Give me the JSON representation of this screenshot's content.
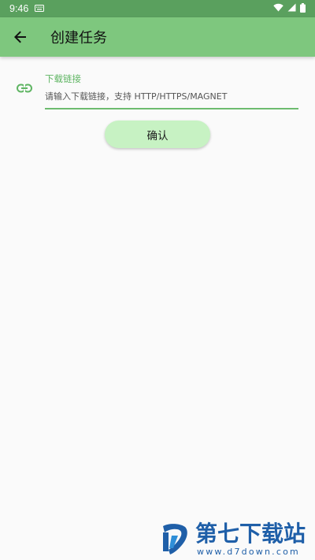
{
  "status_bar": {
    "time": "9:46",
    "icons": [
      "keyboard-icon",
      "wifi-icon",
      "signal-icon",
      "battery-icon"
    ]
  },
  "app_bar": {
    "title": "创建任务",
    "back_icon": "arrow-back-icon",
    "background": "#7ec77e"
  },
  "form": {
    "field_icon": "link-icon",
    "download_link_label": "下载链接",
    "download_link_value": "",
    "download_link_placeholder": "请输入下载链接，支持 HTTP/HTTPS/MAGNET",
    "accent": "#5fb563"
  },
  "actions": {
    "confirm_label": "确认",
    "confirm_background": "#c7f2c3"
  },
  "watermark": {
    "name": "第七下载站",
    "url": "www.d7down.com"
  }
}
